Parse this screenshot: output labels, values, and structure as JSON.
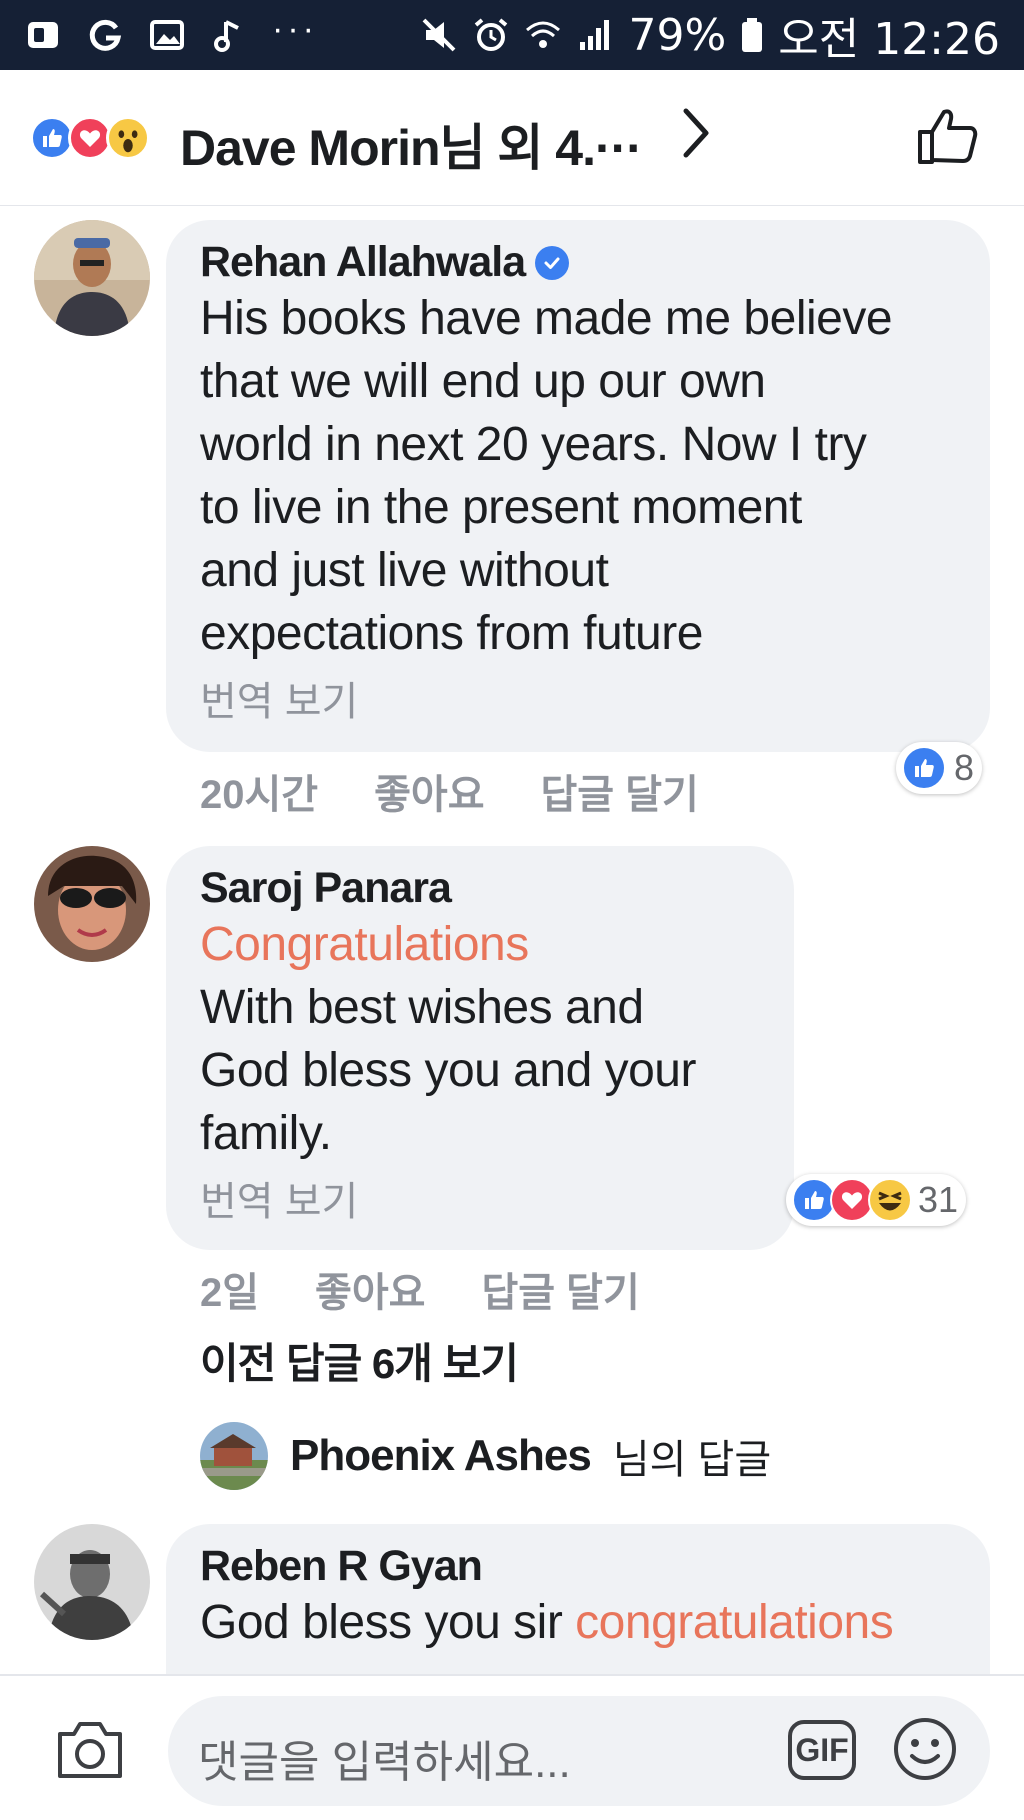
{
  "status_bar": {
    "icons_left": [
      "office-icon",
      "g-refresh-icon",
      "gallery-icon",
      "music-note-icon"
    ],
    "more": "···",
    "icons_right": [
      "mute-icon",
      "alarm-icon",
      "wifi-icon",
      "signal-icon",
      "battery-icon"
    ],
    "battery": "79%",
    "time": "오전 12:26"
  },
  "header": {
    "reactions": [
      "like",
      "love",
      "wow"
    ],
    "title": "Dave Morin님 외 4.···"
  },
  "comments": [
    {
      "author": "Rehan Allahwala",
      "verified": true,
      "lines": [
        "His books have made me believe",
        "that we will end up our own",
        "world in next 20 years. Now I try",
        "to live in the present moment",
        "and just live without",
        "expectations from future"
      ],
      "translate": "번역 보기",
      "time": "20시간",
      "like": "좋아요",
      "reply": "답글 달기",
      "reaction_count": "8"
    },
    {
      "author": "Saroj Panara",
      "accent_line": "Congratulations",
      "lines": [
        "With best wishes and",
        "God bless you and your",
        "family."
      ],
      "translate": "번역 보기",
      "time": "2일",
      "like": "좋아요",
      "reply": "답글 달기",
      "reaction_count": "31"
    },
    {
      "author": "Reben R Gyan",
      "text_prefix": "God bless you sir ",
      "text_accent": "congratulations"
    }
  ],
  "previous_replies": "이전 답글 6개 보기",
  "reply_preview": {
    "name": "Phoenix Ashes",
    "suffix": "님의 답글"
  },
  "composer": {
    "placeholder": "댓글을 입력하세요...",
    "gif": "GIF"
  },
  "colors": {
    "status_bar": "#152035",
    "accent_text": "#e8755b",
    "like_blue": "#3b7ff0",
    "love_red": "#f0405a",
    "haha_yellow": "#f7c844",
    "bubble": "#f0f2f5"
  }
}
